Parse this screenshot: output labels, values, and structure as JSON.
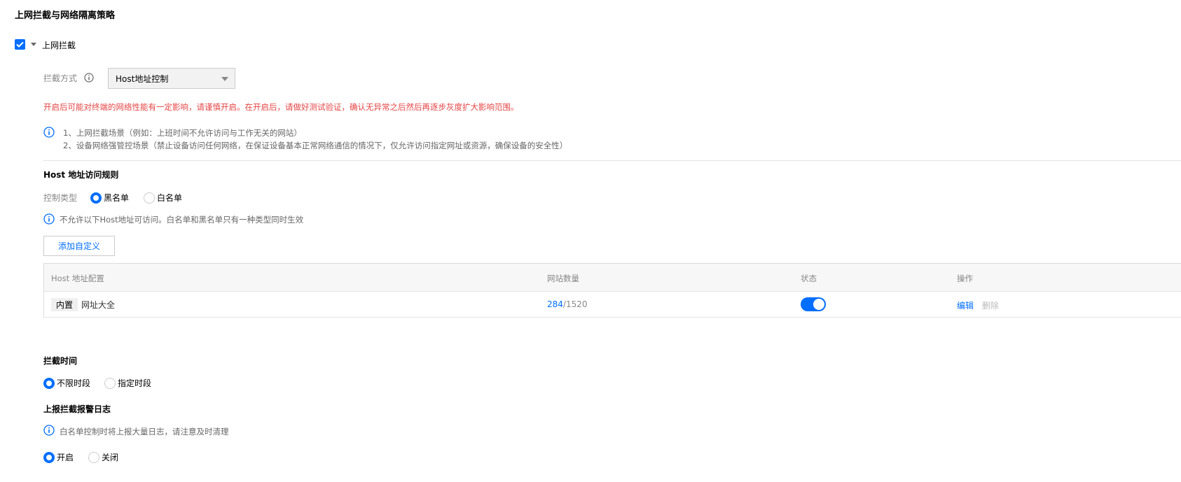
{
  "page": {
    "title": "上网拦截与网络隔离策略"
  },
  "intercept": {
    "checkbox_checked": true,
    "label": "上网拦截",
    "method_label": "拦截方式",
    "method_value": "Host地址控制",
    "warning": "开启后可能对终端的网络性能有一定影响，请谨慎开启。在开启后，请做好测试验证，确认无异常之后然后再逐步灰度扩大影响范围。",
    "tips": [
      "1、上网拦截场景（例如：上班时间不允许访问与工作无关的网站）",
      "2、设备网络强管控场景（禁止设备访问任何网络，在保证设备基本正常网络通信的情况下，仅允许访问指定网址或资源，确保设备的安全性）"
    ]
  },
  "host_rules": {
    "title": "Host 地址访问规则",
    "control_type_label": "控制类型",
    "options": [
      "黑名单",
      "白名单"
    ],
    "selected": "黑名单",
    "tip": "不允许以下Host地址可访问。白名单和黑名单只有一种类型同时生效",
    "add_button": "添加自定义",
    "columns": [
      "Host 地址配置",
      "网站数量",
      "状态",
      "操作"
    ],
    "rows": [
      {
        "tag": "内置",
        "name": "网址大全",
        "count_active": "284",
        "count_total": "/1520",
        "enabled": true,
        "actions": [
          "编辑",
          "删除"
        ]
      }
    ]
  },
  "intercept_time": {
    "title": "拦截时间",
    "options": [
      "不限时段",
      "指定时段"
    ],
    "selected": "不限时段"
  },
  "report_log": {
    "title": "上报拦截报警日志",
    "tip": "白名单控制时将上报大量日志，请注意及时清理",
    "options": [
      "开启",
      "关闭"
    ],
    "selected": "开启"
  },
  "colors": {
    "accent": "#006eff",
    "warning": "#e54545"
  }
}
